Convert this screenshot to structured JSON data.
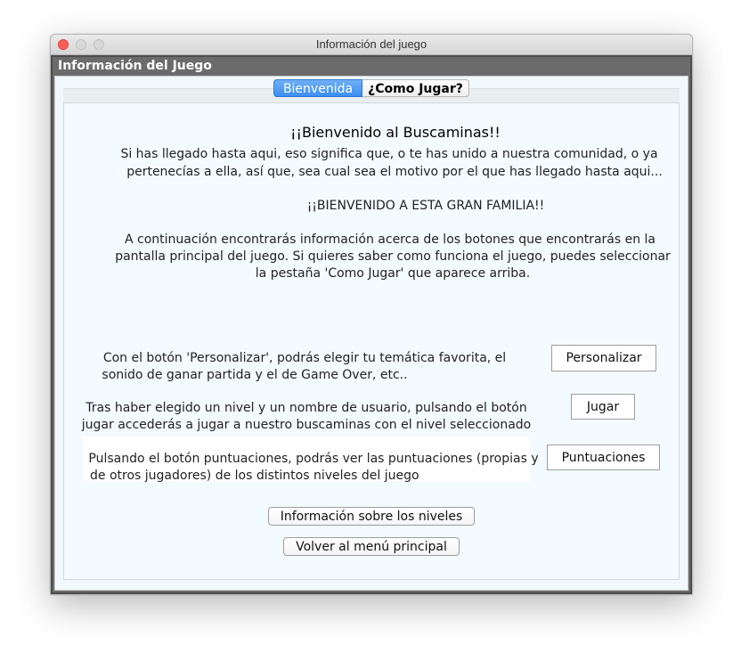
{
  "window": {
    "title": "Información del juego"
  },
  "frame": {
    "title": "Información del Juego"
  },
  "tabs": [
    {
      "label": "Bienvenida",
      "active": true
    },
    {
      "label": "¿Como Jugar?",
      "active": false
    }
  ],
  "welcome": {
    "heading": "¡¡Bienvenido al Buscaminas!!",
    "intro_line1": "Si has llegado hasta aqui, eso significa que, o te has unido a nuestra comunidad, o ya",
    "intro_line2": "pertenecías a ella, así que, sea cual sea el motivo por el que has llegado hasta aqui...",
    "family": "¡¡BIENVENIDO A ESTA GRAN FAMILIA!!",
    "info_line1": "A continuación encontrarás información acerca de los botones que encontrarás en la",
    "info_line2": "pantalla principal del juego. Si quieres saber como funciona el juego, puedes seleccionar",
    "info_line3": "la pestaña 'Como Jugar' que aparece arriba."
  },
  "features": [
    {
      "line1": "Con el botón 'Personalizar', podrás elegir tu temática favorita, el",
      "line2": "sonido de ganar partida y el de Game Over, etc..",
      "button": "Personalizar"
    },
    {
      "line1": "Tras haber elegido un nivel y un nombre de usuario, pulsando el botón",
      "line2": "jugar accederás a jugar a nuestro buscaminas con el nivel seleccionado",
      "button": "Jugar"
    },
    {
      "line1": "Pulsando el botón puntuaciones, podrás ver las puntuaciones (propias y",
      "line2": "de otros jugadores) de los distintos niveles del juego",
      "button": "Puntuaciones"
    }
  ],
  "bottom": {
    "levels_button": "Información sobre los niveles",
    "back_button": "Volver al menú principal"
  },
  "colors": {
    "tab_active": "#3d8ef0",
    "frame": "#6b6b6b",
    "panel": "#f3fbfe",
    "close_button": "#ff5f57"
  }
}
